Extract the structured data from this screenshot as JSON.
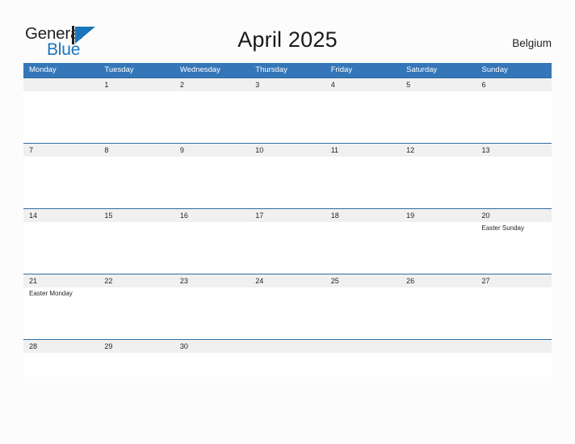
{
  "brand": {
    "logo_general": "General",
    "logo_blue": "Blue",
    "logo_mark_icon": "triangle-flag-icon"
  },
  "header": {
    "title": "April 2025",
    "country": "Belgium"
  },
  "colors": {
    "header_band": "#3576b9",
    "date_band": "#f0f0f0",
    "rule": "#2e6da4",
    "brand_blue": "#1b75bb",
    "text": "#231f20",
    "page_background": "#fcfcfc"
  },
  "calendar": {
    "weekdays": [
      "Monday",
      "Tuesday",
      "Wednesday",
      "Thursday",
      "Friday",
      "Saturday",
      "Sunday"
    ],
    "weeks": [
      {
        "days": [
          {
            "date": "",
            "events": []
          },
          {
            "date": "1",
            "events": []
          },
          {
            "date": "2",
            "events": []
          },
          {
            "date": "3",
            "events": []
          },
          {
            "date": "4",
            "events": []
          },
          {
            "date": "5",
            "events": []
          },
          {
            "date": "6",
            "events": []
          }
        ]
      },
      {
        "days": [
          {
            "date": "7",
            "events": []
          },
          {
            "date": "8",
            "events": []
          },
          {
            "date": "9",
            "events": []
          },
          {
            "date": "10",
            "events": []
          },
          {
            "date": "11",
            "events": []
          },
          {
            "date": "12",
            "events": []
          },
          {
            "date": "13",
            "events": []
          }
        ]
      },
      {
        "days": [
          {
            "date": "14",
            "events": []
          },
          {
            "date": "15",
            "events": []
          },
          {
            "date": "16",
            "events": []
          },
          {
            "date": "17",
            "events": []
          },
          {
            "date": "18",
            "events": []
          },
          {
            "date": "19",
            "events": []
          },
          {
            "date": "20",
            "events": [
              "Easter Sunday"
            ]
          }
        ]
      },
      {
        "days": [
          {
            "date": "21",
            "events": [
              "Easter Monday"
            ]
          },
          {
            "date": "22",
            "events": []
          },
          {
            "date": "23",
            "events": []
          },
          {
            "date": "24",
            "events": []
          },
          {
            "date": "25",
            "events": []
          },
          {
            "date": "26",
            "events": []
          },
          {
            "date": "27",
            "events": []
          }
        ]
      },
      {
        "days": [
          {
            "date": "28",
            "events": []
          },
          {
            "date": "29",
            "events": []
          },
          {
            "date": "30",
            "events": []
          },
          {
            "date": "",
            "events": []
          },
          {
            "date": "",
            "events": []
          },
          {
            "date": "",
            "events": []
          },
          {
            "date": "",
            "events": []
          }
        ]
      }
    ]
  }
}
